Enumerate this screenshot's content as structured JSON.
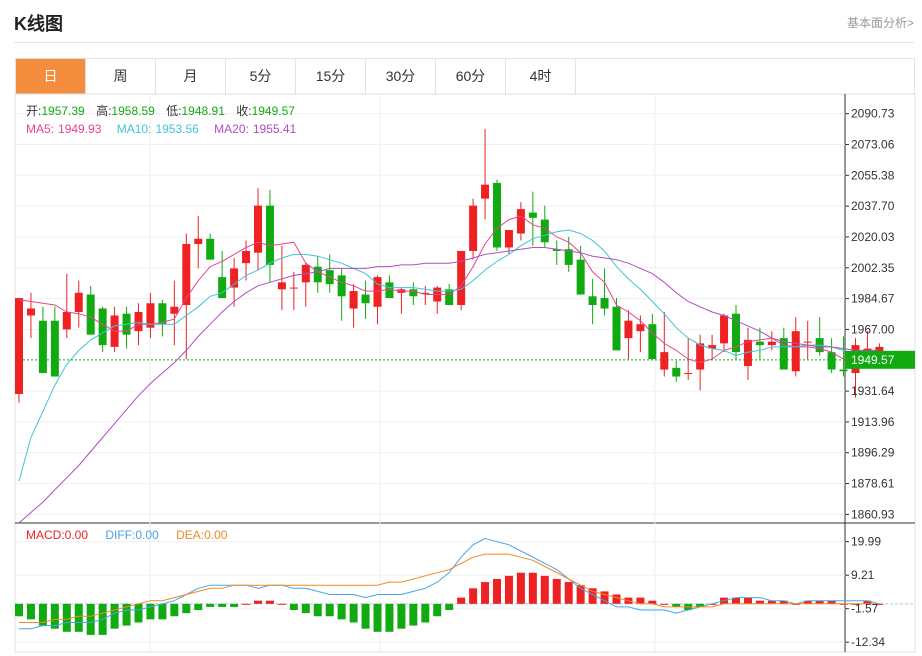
{
  "header": {
    "title": "K线图",
    "basic_link": "基本面分析>"
  },
  "tabs": [
    {
      "label": "日",
      "active": true
    },
    {
      "label": "周",
      "active": false
    },
    {
      "label": "月",
      "active": false
    },
    {
      "label": "5分",
      "active": false
    },
    {
      "label": "15分",
      "active": false
    },
    {
      "label": "30分",
      "active": false
    },
    {
      "label": "60分",
      "active": false
    },
    {
      "label": "4时",
      "active": false
    }
  ],
  "info": {
    "open_label": "开:",
    "open": "1957.39",
    "high_label": "高:",
    "high": "1958.59",
    "low_label": "低:",
    "low": "1948.91",
    "close_label": "收:",
    "close": "1949.57",
    "ma5_label": "MA5:",
    "ma5": "1949.93",
    "ma10_label": "MA10:",
    "ma10": "1953.56",
    "ma20_label": "MA20:",
    "ma20": "1955.41"
  },
  "macd_info": {
    "macd_label": "MACD:",
    "macd": "0.00",
    "diff_label": "DIFF:",
    "diff": "0.00",
    "dea_label": "DEA:",
    "dea": "0.00"
  },
  "colors": {
    "up": "#ee2222",
    "down": "#11aa11",
    "ma5": "#e8438f",
    "ma10": "#3fc4d6",
    "ma20": "#b04ec0",
    "diff": "#4aa3e8",
    "dea": "#f08a24",
    "accent": "#f48c3e"
  },
  "chart_data": [
    {
      "type": "candlestick",
      "price_ticks": [
        "2090.73",
        "2073.06",
        "2055.38",
        "2037.70",
        "2020.03",
        "2002.35",
        "1984.67",
        "1967.00",
        "1949.57",
        "1931.64",
        "1913.96",
        "1896.29",
        "1878.61",
        "1860.93"
      ],
      "last_price": 1949.57,
      "ylim": [
        1856,
        2102
      ],
      "candles": [
        [
          1930,
          1985,
          1925,
          1985
        ],
        [
          1975,
          1988,
          1962,
          1979
        ],
        [
          1972,
          1980,
          1946,
          1942
        ],
        [
          1972,
          1980,
          1946,
          1940
        ],
        [
          1967,
          1999,
          1962,
          1977
        ],
        [
          1977,
          1995,
          1968,
          1988
        ],
        [
          1987,
          1992,
          1968,
          1964
        ],
        [
          1979,
          1980,
          1954,
          1958
        ],
        [
          1957,
          1980,
          1954,
          1975
        ],
        [
          1976,
          1980,
          1956,
          1964
        ],
        [
          1966,
          1982,
          1958,
          1977
        ],
        [
          1968,
          1988,
          1962,
          1982
        ],
        [
          1982,
          1984,
          1963,
          1970
        ],
        [
          1976,
          1995,
          1958,
          1980
        ],
        [
          1981,
          2022,
          1950,
          2016
        ],
        [
          2016,
          2032,
          2002,
          2019
        ],
        [
          2019,
          2022,
          2007,
          2007
        ],
        [
          1997,
          2012,
          1988,
          1985
        ],
        [
          1991,
          2008,
          1980,
          2002
        ],
        [
          2005,
          2018,
          1995,
          2012
        ],
        [
          2011,
          2048,
          2001,
          2038
        ],
        [
          2038,
          2047,
          1994,
          2004
        ],
        [
          1990,
          2015,
          1978,
          1994
        ],
        [
          1991,
          2000,
          1978,
          1991
        ],
        [
          1994,
          2005,
          1980,
          2004
        ],
        [
          2003,
          2009,
          1988,
          1994
        ],
        [
          2001,
          2010,
          1988,
          1993
        ],
        [
          1998,
          2002,
          1972,
          1986
        ],
        [
          1979,
          1993,
          1968,
          1989
        ],
        [
          1987,
          1995,
          1973,
          1982
        ],
        [
          1980,
          1998,
          1970,
          1997
        ],
        [
          1994,
          1998,
          1985,
          1985
        ],
        [
          1988,
          1991,
          1976,
          1990
        ],
        [
          1990,
          1994,
          1981,
          1986
        ],
        [
          1988,
          1992,
          1981,
          1988
        ],
        [
          1983,
          1992,
          1976,
          1991
        ],
        [
          1990,
          1993,
          1983,
          1981
        ],
        [
          1981,
          2012,
          1978,
          2012
        ],
        [
          2012,
          2042,
          2007,
          2038
        ],
        [
          2042,
          2082,
          2030,
          2050
        ],
        [
          2051,
          2053,
          2012,
          2014
        ],
        [
          2014,
          2023,
          2010,
          2024
        ],
        [
          2022,
          2040,
          2018,
          2036
        ],
        [
          2034,
          2046,
          2015,
          2031
        ],
        [
          2030,
          2038,
          2014,
          2017
        ],
        [
          2013,
          2018,
          2004,
          2012
        ],
        [
          2013,
          2020,
          2000,
          2004
        ],
        [
          2007,
          2015,
          1990,
          1987
        ],
        [
          1986,
          1996,
          1970,
          1981
        ],
        [
          1985,
          2002,
          1975,
          1979
        ],
        [
          1980,
          1985,
          1955,
          1955
        ],
        [
          1962,
          1978,
          1950,
          1972
        ],
        [
          1966,
          1975,
          1954,
          1970
        ],
        [
          1970,
          1976,
          1960,
          1950
        ],
        [
          1944,
          1977,
          1940,
          1954
        ],
        [
          1945,
          1949,
          1937,
          1940
        ],
        [
          1942,
          1962,
          1938,
          1942
        ],
        [
          1944,
          1964,
          1932,
          1959
        ],
        [
          1956,
          1964,
          1950,
          1958
        ],
        [
          1959,
          1976,
          1954,
          1975
        ],
        [
          1976,
          1981,
          1950,
          1954
        ],
        [
          1946,
          1968,
          1938,
          1961
        ],
        [
          1960,
          1968,
          1950,
          1958
        ],
        [
          1958,
          1966,
          1955,
          1960
        ],
        [
          1962,
          1968,
          1944,
          1944
        ],
        [
          1943,
          1974,
          1940,
          1966
        ],
        [
          1960,
          1972,
          1950,
          1960
        ],
        [
          1962,
          1974,
          1952,
          1954
        ],
        [
          1954,
          1962,
          1942,
          1944
        ],
        [
          1944,
          1963,
          1940,
          1943
        ],
        [
          1942,
          1962,
          1928,
          1958
        ],
        [
          1950,
          1966,
          1948,
          1956
        ],
        [
          1949,
          1959,
          1949,
          1957
        ]
      ],
      "series": [
        {
          "name": "MA5",
          "values": [
            1984,
            1983,
            1982,
            1981,
            1977,
            1976,
            1974,
            1970,
            1966,
            1966,
            1970,
            1970,
            1971,
            1973,
            1985,
            1995,
            2003,
            2006,
            2010,
            2014,
            2017,
            2015,
            2016,
            2017,
            2005,
            2000,
            1997,
            1994,
            1992,
            1989,
            1989,
            1990,
            1989,
            1989,
            1987,
            1987,
            1987,
            1992,
            2003,
            2016,
            2025,
            2030,
            2032,
            2027,
            2025,
            2020,
            2017,
            2011,
            2000,
            1994,
            1981,
            1977,
            1972,
            1965,
            1959,
            1955,
            1950,
            1948,
            1950,
            1955,
            1957,
            1960,
            1961,
            1962,
            1958,
            1957,
            1957,
            1956,
            1954,
            1950,
            1950,
            1952,
            1950
          ]
        },
        {
          "name": "MA10",
          "values": [
            1880,
            1905,
            1920,
            1935,
            1947,
            1955,
            1961,
            1965,
            1969,
            1970,
            1971,
            1970,
            1970,
            1970,
            1975,
            1980,
            1986,
            1988,
            1993,
            1998,
            2001,
            2005,
            2008,
            2010,
            2010,
            2009,
            2007,
            2005,
            2002,
            1999,
            1993,
            1991,
            1991,
            1991,
            1990,
            1989,
            1989,
            1990,
            1995,
            2001,
            2006,
            2010,
            2015,
            2019,
            2021,
            2023,
            2024,
            2022,
            2018,
            2012,
            2003,
            1996,
            1990,
            1983,
            1976,
            1968,
            1962,
            1958,
            1956,
            1955,
            1952,
            1954,
            1955,
            1957,
            1957,
            1957,
            1958,
            1958,
            1957,
            1955,
            1953,
            1953,
            1953
          ]
        },
        {
          "name": "MA20",
          "values": [
            1855,
            1862,
            1868,
            1875,
            1882,
            1889,
            1897,
            1905,
            1913,
            1921,
            1929,
            1936,
            1942,
            1948,
            1955,
            1963,
            1970,
            1977,
            1983,
            1988,
            1992,
            1994,
            1996,
            1998,
            1999,
            2000,
            2002,
            2002,
            2002,
            2002,
            2003,
            2003,
            2004,
            2004,
            2005,
            2005,
            2005,
            2006,
            2008,
            2010,
            2011,
            2012,
            2013,
            2014,
            2014,
            2013,
            2012,
            2011,
            2009,
            2008,
            2007,
            2005,
            2002,
            1999,
            1994,
            1988,
            1983,
            1980,
            1977,
            1975,
            1972,
            1969,
            1966,
            1962,
            1960,
            1959,
            1958,
            1957,
            1957,
            1956,
            1955,
            1955,
            1955
          ]
        }
      ]
    },
    {
      "type": "macd",
      "ticks": [
        "19.99",
        "9.21",
        "-1.57",
        "-12.34"
      ],
      "ylim": [
        -15.5,
        26
      ],
      "macd": [
        -4,
        -5,
        -7,
        -8,
        -9,
        -9,
        -10,
        -10,
        -8,
        -7,
        -6,
        -5,
        -5,
        -4,
        -3,
        -2,
        -1,
        -1,
        -1,
        0,
        1,
        1,
        0,
        -2,
        -3,
        -4,
        -4,
        -5,
        -6,
        -8,
        -9,
        -9,
        -8,
        -7,
        -6,
        -4,
        -2,
        2,
        5,
        7,
        8,
        9,
        10,
        10,
        9,
        8,
        7,
        6,
        5,
        4,
        3,
        2,
        2,
        1,
        0,
        -1,
        -2,
        -1,
        0,
        2,
        2,
        2,
        1,
        1,
        1,
        0,
        1,
        1,
        1,
        0,
        0,
        1,
        0
      ],
      "diff": [
        -8,
        -8,
        -7,
        -7,
        -6,
        -6,
        -6,
        -5,
        -3,
        -2,
        -2,
        -1,
        0,
        1,
        3,
        5,
        6,
        6,
        6,
        6,
        5,
        6,
        6,
        5,
        5,
        4,
        3,
        3,
        3,
        2,
        3,
        3,
        3,
        4,
        5,
        7,
        10,
        15,
        19,
        21,
        20,
        19,
        17,
        15,
        13,
        11,
        8,
        5,
        3,
        1,
        -1,
        -1,
        -2,
        -2,
        -2,
        -3,
        -2,
        -1,
        0,
        1,
        2,
        2,
        2,
        1,
        1,
        0,
        1,
        1,
        1,
        1,
        1,
        1,
        0
      ],
      "dea": [
        -6,
        -6,
        -6,
        -5,
        -5,
        -4,
        -4,
        -3,
        -2,
        -1,
        0,
        1,
        1,
        2,
        3,
        4,
        5,
        5,
        6,
        6,
        6,
        6,
        6,
        6,
        6,
        6,
        6,
        6,
        6,
        6,
        6,
        7,
        7,
        8,
        9,
        10,
        11,
        13,
        15,
        16,
        16,
        16,
        15,
        14,
        12,
        10,
        8,
        6,
        4,
        3,
        2,
        1,
        0,
        0,
        -1,
        -1,
        -1,
        -1,
        -1,
        0,
        0,
        0,
        0,
        0,
        0,
        0,
        0,
        0,
        0,
        0,
        0,
        0,
        0
      ]
    }
  ]
}
